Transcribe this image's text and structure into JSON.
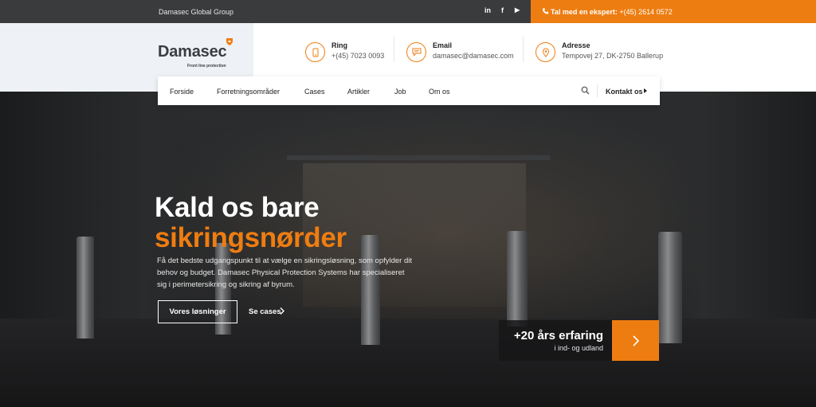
{
  "topbar": {
    "group_label": "Damasec Global Group",
    "social": [
      "in",
      "f",
      "▶"
    ],
    "cta_prefix": "Tal med en ekspert:",
    "cta_phone": "+(45) 2614 0572"
  },
  "logo": {
    "name": "Damasec",
    "tagline": "Front line protection"
  },
  "contacts": [
    {
      "label": "Ring",
      "value": "+(45) 7023 0093",
      "icon": "phone-icon"
    },
    {
      "label": "Email",
      "value": "damasec@damasec.com",
      "icon": "chat-icon"
    },
    {
      "label": "Adresse",
      "value": "Tempovej 27, DK-2750 Ballerup",
      "icon": "map-pin-icon"
    }
  ],
  "nav": {
    "items": [
      "Forside",
      "Forretningsområder",
      "Cases",
      "Artikler",
      "Job",
      "Om os"
    ],
    "kontakt": "Kontakt os"
  },
  "hero": {
    "title_line1": "Kald os bare",
    "title_line2": "sikringsnørder",
    "description": "Få det bedste udgangspunkt til at vælge en sikringsløsning, som opfylder dit behov og budget. Damasec Physical Protection Systems har specialiseret sig i perimetersikring og sikring af byrum.",
    "primary_button": "Vores løsninger",
    "secondary_link": "Se cases"
  },
  "experience": {
    "headline": "+20 års erfaring",
    "subline": "i ind- og udland"
  },
  "colors": {
    "accent": "#ee7d11",
    "topbar": "#3a3b3d",
    "logo_bg": "#eef1f5"
  }
}
